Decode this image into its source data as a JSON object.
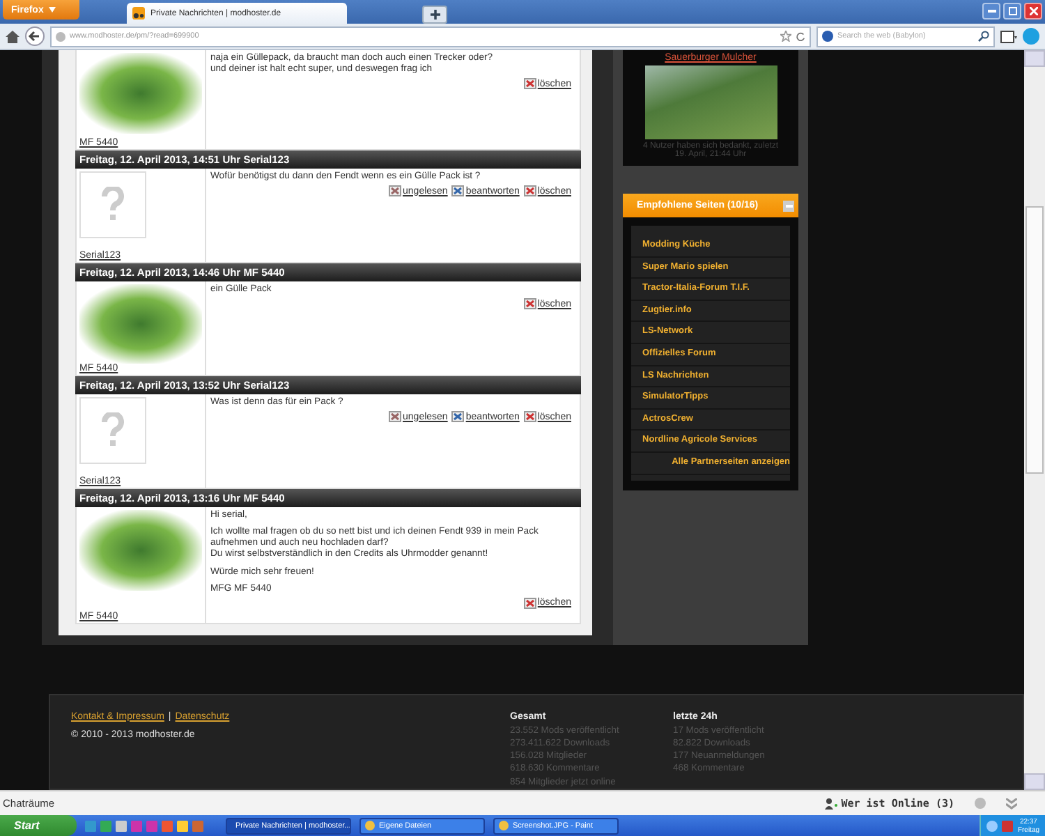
{
  "browser": {
    "menu_button": "Firefox",
    "tab_title": "Private Nachrichten | modhoster.de",
    "url": "www.modhoster.de/pm/?read=699900",
    "search_placeholder": "Search the web (Babylon)"
  },
  "messages": [
    {
      "has_photo": true,
      "user": "MF 5440",
      "paragraphs": [
        "naja ein Güllepack, da braucht man doch auch einen Trecker oder?\nund deiner ist halt echt super, und deswegen frag ich"
      ],
      "actions": [
        {
          "kind": "delete",
          "label": "löschen"
        }
      ]
    },
    {
      "header": "Freitag, 12. April 2013, 14:51 Uhr Serial123",
      "has_photo": false,
      "user": "Serial123",
      "paragraphs": [
        "Wofür benötigst du dann den Fendt wenn es ein Gülle Pack ist ?"
      ],
      "actions": [
        {
          "kind": "unread",
          "label": "ungelesen"
        },
        {
          "kind": "reply",
          "label": "beantworten"
        },
        {
          "kind": "delete",
          "label": "löschen"
        }
      ]
    },
    {
      "header": "Freitag, 12. April 2013, 14:46 Uhr MF 5440",
      "has_photo": true,
      "user": "MF 5440",
      "paragraphs": [
        "ein Gülle Pack"
      ],
      "actions": [
        {
          "kind": "delete",
          "label": "löschen"
        }
      ]
    },
    {
      "header": "Freitag, 12. April 2013, 13:52 Uhr Serial123",
      "has_photo": false,
      "user": "Serial123",
      "paragraphs": [
        "Was ist denn das für ein Pack ?"
      ],
      "actions": [
        {
          "kind": "unread",
          "label": "ungelesen"
        },
        {
          "kind": "reply",
          "label": "beantworten"
        },
        {
          "kind": "delete",
          "label": "löschen"
        }
      ]
    },
    {
      "header": "Freitag, 12. April 2013, 13:16 Uhr MF 5440",
      "has_photo": true,
      "user": "MF 5440",
      "paragraphs": [
        "Hi serial,",
        "Ich wollte mal fragen ob du so nett bist und ich deinen Fendt 939 in mein Pack aufnehmen und auch neu hochladen darf?\nDu wirst selbstverständlich in den Credits als Uhrmodder genannt!",
        "Würde mich sehr freuen!",
        "MFG MF 5440"
      ],
      "actions": [
        {
          "kind": "delete",
          "label": "löschen"
        }
      ]
    }
  ],
  "sidebar": {
    "mod_link": "Sauerburger Mulcher",
    "thanks": "4 Nutzer haben sich bedankt, zuletzt\n19. April, 21:44 Uhr",
    "recommended_title": "Empfohlene Seiten (10/16)",
    "links": [
      "Modding Küche",
      "Super Mario spielen",
      "Tractor-Italia-Forum T.I.F.",
      "Zugtier.info",
      "LS-Network",
      "Offizielles Forum",
      "LS Nachrichten",
      "SimulatorTipps",
      "ActrosCrew",
      "Nordline Agricole Services"
    ],
    "all_link": "Alle Partnerseiten anzeigen"
  },
  "footer": {
    "links": [
      "Kontakt & Impressum",
      "Datenschutz"
    ],
    "separator": "|",
    "copyright": "© 2010 - 2013 modhoster.de",
    "stats": [
      {
        "title": "Gesamt",
        "lines": [
          "23.552 Mods veröffentlicht",
          "273.411.622 Downloads",
          "156.028 Mitglieder",
          "618.630 Kommentare",
          "854 Mitglieder jetzt online"
        ]
      },
      {
        "title": "letzte 24h",
        "lines": [
          "17 Mods veröffentlicht",
          "82.822 Downloads",
          "177 Neuanmeldungen",
          "468 Kommentare"
        ]
      }
    ]
  },
  "chat_bar": {
    "rooms": "Chaträume",
    "online": "Wer ist Online (3)"
  },
  "taskbar": {
    "start": "Start",
    "tasks": [
      {
        "label": "Private Nachrichten | modhoster...",
        "selected": true
      },
      {
        "label": "Eigene Dateien",
        "selected": false
      },
      {
        "label": "Screenshot.JPG - Paint",
        "selected": false
      }
    ],
    "time": "22:37",
    "day": "Freitag"
  }
}
